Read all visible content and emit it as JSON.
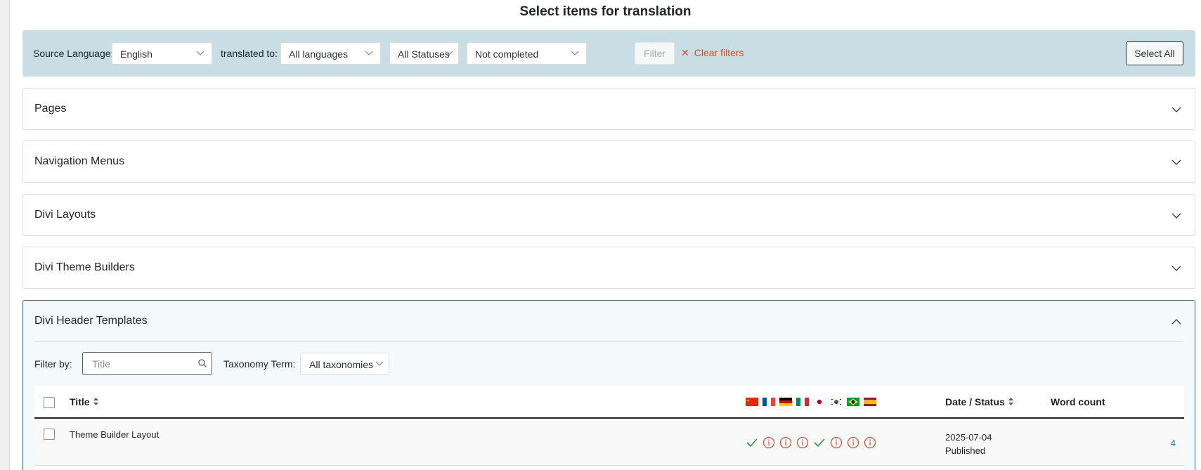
{
  "page": {
    "title": "Select items for translation"
  },
  "filters": {
    "source_language_label": "Source Language:",
    "source_language_value": "English",
    "translated_to_label": "translated to:",
    "translated_to_value": "All languages",
    "status_value": "All Statuses",
    "completion_value": "Not completed",
    "filter_button": "Filter",
    "clear_filters": "Clear filters",
    "select_all": "Select All"
  },
  "sections": [
    {
      "title": "Pages",
      "expanded": false
    },
    {
      "title": "Navigation Menus",
      "expanded": false
    },
    {
      "title": "Divi Layouts",
      "expanded": false
    },
    {
      "title": "Divi Theme Builders",
      "expanded": false
    },
    {
      "title": "Divi Header Templates",
      "expanded": true
    }
  ],
  "open_section": {
    "filter_by_label": "Filter by:",
    "search_placeholder": "Title",
    "taxonomy_label": "Taxonomy Term:",
    "taxonomy_value": "All taxonomies",
    "columns": {
      "title": "Title",
      "date_status": "Date / Status",
      "word_count": "Word count"
    },
    "languages": [
      "zh",
      "fr",
      "de",
      "it",
      "ja",
      "ko",
      "pt-br",
      "es"
    ],
    "rows": [
      {
        "title": "Theme Builder Layout",
        "statuses": [
          "complete",
          "needs-update",
          "needs-update",
          "needs-update",
          "complete",
          "needs-update",
          "needs-update",
          "needs-update"
        ],
        "date": "2025-07-04",
        "status": "Published",
        "word_count": "4"
      }
    ]
  },
  "colors": {
    "filter_bar_bg": "#c9dde4",
    "accent_orange": "#d54e21",
    "link_blue": "#2271b1",
    "check_green": "#2e8b57",
    "open_border": "#2f6a8c"
  }
}
